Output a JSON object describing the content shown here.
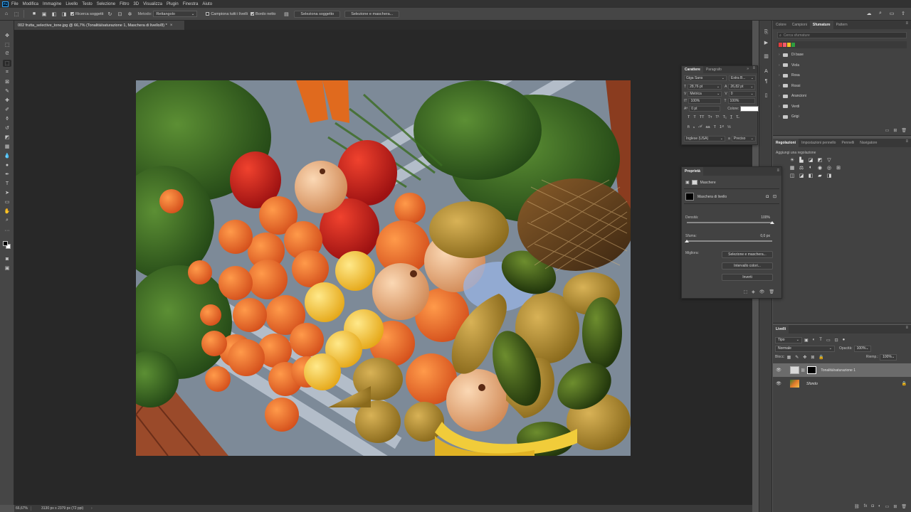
{
  "app": {
    "name": "Ps"
  },
  "menu": [
    "File",
    "Modifica",
    "Immagine",
    "Livello",
    "Testo",
    "Selezione",
    "Filtro",
    "3D",
    "Visualizza",
    "Plugin",
    "Finestra",
    "Aiuto"
  ],
  "options_bar": {
    "sample_all_label": "Ricerca soggetti",
    "method_label": "Metodo:",
    "method_value": "Rettangolo",
    "sample_all_layers": "Campiona tutti i livelli",
    "hard_edge": "Bordo netto",
    "select_subject": "Seleziona soggetto",
    "select_and_mask": "Selezione e maschera..."
  },
  "document": {
    "tab_title": "002 frutta_selective_tone.jpg @ 66,7% (Tonalità/saturazione 1, Maschera di livello/8) *"
  },
  "status": {
    "zoom": "66,67%",
    "info": "3130 px x 2379 px (72 ppi)"
  },
  "gradients_panel": {
    "tabs": [
      "Colore",
      "Campioni",
      "Sfumature",
      "Pattern"
    ],
    "active_tab": "Sfumature",
    "search_placeholder": "Cerca sfumature",
    "chip_colors": [
      "#e23b3b",
      "#f25a6a",
      "#f4c020",
      "#2e9e3e"
    ],
    "folders": [
      "Di base",
      "Viola",
      "Rosa",
      "Rossi",
      "Arancioni",
      "Verdi",
      "Grigi"
    ]
  },
  "adjustments_panel": {
    "tabs": [
      "Regolazioni",
      "Impostazioni pennello",
      "Pennelli",
      "Navigatore"
    ],
    "active_tab": "Regolazioni",
    "subtitle": "Aggiungi una regolazione"
  },
  "layers_panel": {
    "tab": "Livelli",
    "filter_kind": "Tipo",
    "blend_mode": "Normale",
    "opacity_label": "Opacità:",
    "opacity_value": "100%",
    "lock_label": "Blocc:",
    "fill_label": "Riemp.:",
    "fill_value": "100%",
    "layers": [
      {
        "name": "Tonalità/saturazione 1",
        "selected": true
      },
      {
        "name": "Sfondo",
        "selected": false,
        "locked": true
      }
    ]
  },
  "character_panel": {
    "tabs": [
      "Carattere",
      "Paragrafo"
    ],
    "active_tab": "Carattere",
    "font_family": "Giga Sans",
    "font_style": "Extra B...",
    "font_size": "28,76 pt",
    "leading": "26,82 pt",
    "kerning": "Metrica",
    "tracking": "0",
    "vertical_scale": "100%",
    "horizontal_scale": "100%",
    "baseline_shift": "0 pt",
    "color_label": "Colore:",
    "language": "Inglese (USA)",
    "antialias": "Preciso"
  },
  "properties_panel": {
    "tab": "Proprietà",
    "section": "Maschere",
    "mask_label": "Maschera di livello",
    "density_label": "Densità:",
    "density_value": "100%",
    "feather_label": "Sfuma:",
    "feather_value": "0,0 px",
    "refine_label": "Migliora:",
    "btn_select_mask": "Selezione e maschera...",
    "btn_color_range": "Intervallo colori...",
    "btn_invert": "Inverti"
  }
}
